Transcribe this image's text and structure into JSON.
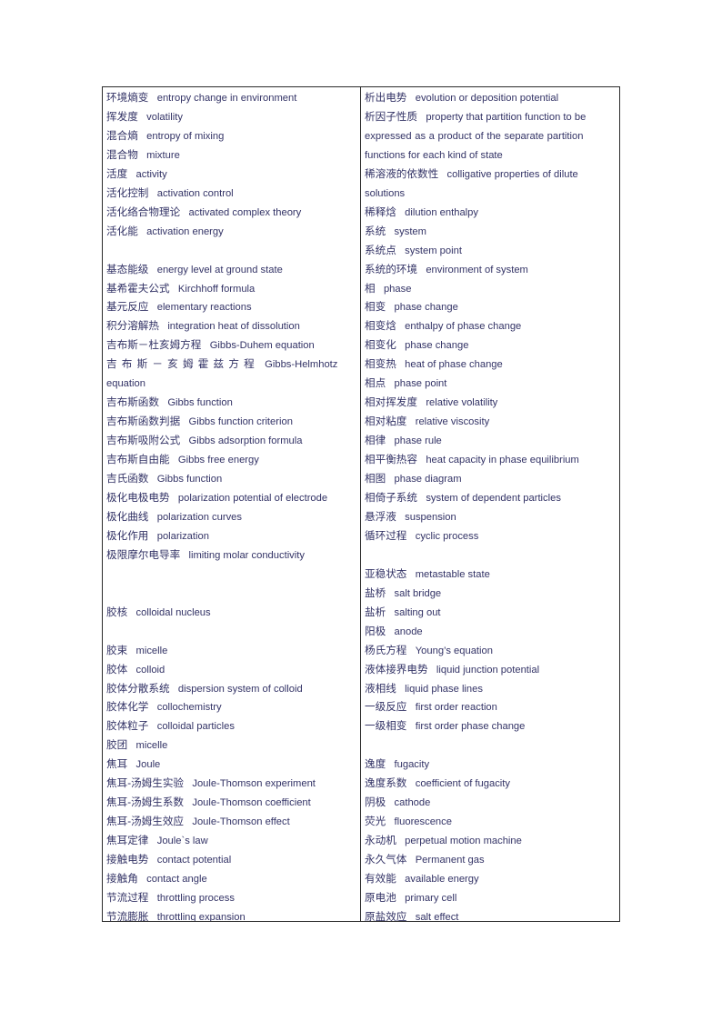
{
  "document": {
    "type": "bilingual-glossary-table",
    "text_color": "#333366",
    "border_color": "#2b2b2b",
    "background": "#ffffff",
    "columns": 2
  },
  "left_column": [
    {
      "cjk": "环境熵变",
      "en": "entropy change in environment"
    },
    {
      "cjk": "挥发度",
      "en": "volatility"
    },
    {
      "cjk": "混合熵",
      "en": "entropy of mixing"
    },
    {
      "cjk": "混合物",
      "en": "mixture"
    },
    {
      "cjk": "活度",
      "en": "activity"
    },
    {
      "cjk": "活化控制",
      "en": "activation control"
    },
    {
      "cjk": "活化络合物理论",
      "en": "activated complex theory"
    },
    {
      "cjk": "活化能",
      "en": "activation energy"
    },
    {
      "blank": 1
    },
    {
      "cjk": "基态能级",
      "en": "energy level at ground state"
    },
    {
      "cjk": "基希霍夫公式",
      "en": "Kirchhoff formula"
    },
    {
      "cjk": "基元反应",
      "en": "elementary reactions"
    },
    {
      "cjk": "积分溶解热",
      "en": "integration heat of dissolution"
    },
    {
      "cjk": "吉布斯－杜亥姆方程",
      "en": "Gibbs-Duhem equation"
    },
    {
      "cjk": "吉布斯－亥姆霍兹方程",
      "en": "Gibbs-Helmhotz",
      "cont": "equation",
      "spread": true
    },
    {
      "cjk": "吉布斯函数",
      "en": "Gibbs function"
    },
    {
      "cjk": "吉布斯函数判据",
      "en": "Gibbs function criterion"
    },
    {
      "cjk": "吉布斯吸附公式",
      "en": "Gibbs adsorption formula"
    },
    {
      "cjk": "吉布斯自由能",
      "en": "Gibbs free energy"
    },
    {
      "cjk": "吉氏函数",
      "en": "Gibbs function"
    },
    {
      "cjk": "极化电极电势",
      "en": "polarization potential of electrode"
    },
    {
      "cjk": "极化曲线",
      "en": "polarization curves"
    },
    {
      "cjk": "极化作用",
      "en": "polarization"
    },
    {
      "cjk": "极限摩尔电导率",
      "en": "limiting molar conductivity"
    },
    {
      "blank": 2
    },
    {
      "cjk": "胶核",
      "en": "colloidal nucleus"
    },
    {
      "blank": 1
    },
    {
      "cjk": "胶束",
      "en": "micelle"
    },
    {
      "cjk": "胶体",
      "en": "colloid"
    },
    {
      "cjk": "胶体分散系统",
      "en": "dispersion system of colloid"
    },
    {
      "cjk": "胶体化学",
      "en": "collochemistry"
    },
    {
      "cjk": "胶体粒子",
      "en": "colloidal particles"
    },
    {
      "cjk": "胶团",
      "en": "micelle"
    },
    {
      "cjk": "焦耳",
      "en": "Joule"
    },
    {
      "cjk": "焦耳-汤姆生实验",
      "en": "Joule-Thomson experiment"
    },
    {
      "cjk": "焦耳-汤姆生系数",
      "en": "Joule-Thomson coefficient"
    },
    {
      "cjk": "焦耳-汤姆生效应",
      "en": "Joule-Thomson effect"
    },
    {
      "cjk": "焦耳定律",
      "en": "Joule`s law"
    },
    {
      "cjk": "接触电势",
      "en": "contact potential"
    },
    {
      "cjk": "接触角",
      "en": "contact angle"
    },
    {
      "cjk": "节流过程",
      "en": "throttling process"
    },
    {
      "cjk": "节流膨胀",
      "en": "throttling expansion"
    }
  ],
  "right_column": [
    {
      "cjk": "析出电势",
      "en": "evolution or deposition potential"
    },
    {
      "cjk": "析因子性质",
      "en": "property that partition function to be",
      "wrapped": [
        "expressed as a product of the separate partition",
        "functions for each kind of state"
      ]
    },
    {
      "cjk": "稀溶液的依数性",
      "en": "colligative properties of dilute",
      "wrapped": [
        "solutions"
      ]
    },
    {
      "cjk": "稀释焓",
      "en": "dilution enthalpy"
    },
    {
      "cjk": "系统",
      "en": "system"
    },
    {
      "cjk": "系统点",
      "en": "system point"
    },
    {
      "cjk": "系统的环境",
      "en": "environment of system"
    },
    {
      "cjk": "相",
      "en": "phase"
    },
    {
      "cjk": "相变",
      "en": "phase change"
    },
    {
      "cjk": "相变焓",
      "en": "enthalpy of phase change"
    },
    {
      "cjk": "相变化",
      "en": "phase change"
    },
    {
      "cjk": "相变热",
      "en": "heat of phase change"
    },
    {
      "cjk": "相点",
      "en": "phase point"
    },
    {
      "cjk": "相对挥发度",
      "en": "relative volatility"
    },
    {
      "cjk": "相对粘度",
      "en": "relative viscosity"
    },
    {
      "cjk": "相律",
      "en": "phase rule"
    },
    {
      "cjk": "相平衡热容",
      "en": "heat capacity in phase equilibrium"
    },
    {
      "cjk": "相图",
      "en": "phase diagram"
    },
    {
      "cjk": "相倚子系统",
      "en": "system of dependent particles"
    },
    {
      "cjk": "悬浮液",
      "en": "suspension"
    },
    {
      "cjk": "循环过程",
      "en": "cyclic process"
    },
    {
      "blank": 1
    },
    {
      "cjk": "亚稳状态",
      "en": "metastable state"
    },
    {
      "cjk": "盐桥",
      "en": "salt bridge"
    },
    {
      "cjk": "盐析",
      "en": "salting out"
    },
    {
      "cjk": "阳极",
      "en": "anode"
    },
    {
      "cjk": "杨氏方程",
      "en": "Young’s equation"
    },
    {
      "cjk": "液体接界电势",
      "en": "liquid junction potential"
    },
    {
      "cjk": "液相线",
      "en": "liquid phase lines"
    },
    {
      "cjk": "一级反应",
      "en": "first order reaction"
    },
    {
      "cjk": "一级相变",
      "en": "first order phase change"
    },
    {
      "blank": 1
    },
    {
      "cjk": "逸度",
      "en": "fugacity"
    },
    {
      "cjk": "逸度系数",
      "en": "coefficient of fugacity"
    },
    {
      "cjk": "阴极",
      "en": "cathode"
    },
    {
      "cjk": "荧光",
      "en": "fluorescence"
    },
    {
      "cjk": "永动机",
      "en": "perpetual motion machine"
    },
    {
      "cjk": "永久气体",
      "en": "Permanent gas"
    },
    {
      "cjk": "有效能",
      "en": "available energy"
    },
    {
      "cjk": "原电池",
      "en": "primary cell"
    },
    {
      "cjk": "原盐效应",
      "en": "salt effect"
    }
  ]
}
